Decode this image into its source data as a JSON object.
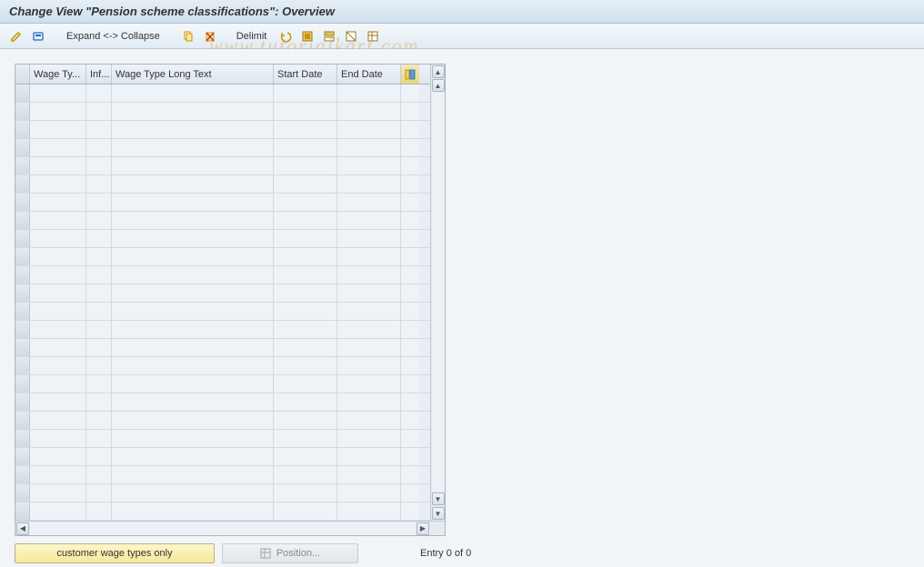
{
  "title": "Change View \"Pension scheme classifications\": Overview",
  "toolbar": {
    "expand_collapse": "Expand <-> Collapse",
    "delimit": "Delimit"
  },
  "columns": {
    "wage_type": "Wage Ty...",
    "inf": "Inf...",
    "wage_long": "Wage Type Long Text",
    "start": "Start Date",
    "end": "End Date"
  },
  "rows": [
    {},
    {},
    {},
    {},
    {},
    {},
    {},
    {},
    {},
    {},
    {},
    {},
    {},
    {},
    {},
    {},
    {},
    {},
    {},
    {},
    {},
    {},
    {},
    {}
  ],
  "buttons": {
    "customer_wage": "customer wage types only",
    "position": "Position..."
  },
  "status": {
    "entry": "Entry 0 of 0"
  },
  "watermark": "www.tutorialkart.com"
}
